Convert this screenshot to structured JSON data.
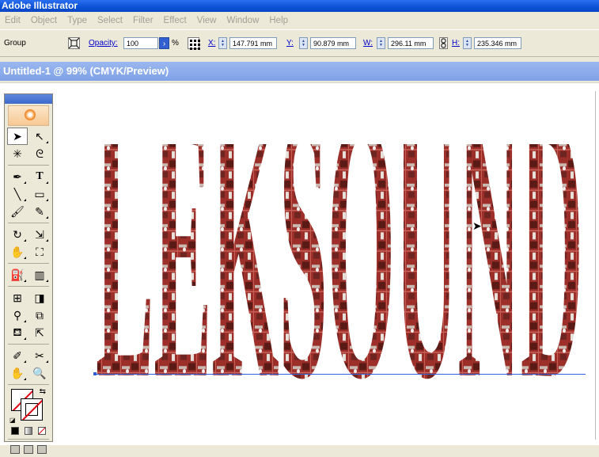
{
  "app": {
    "title": "Adobe Illustrator"
  },
  "menu": [
    "Edit",
    "Object",
    "Type",
    "Select",
    "Filter",
    "Effect",
    "View",
    "Window",
    "Help"
  ],
  "control": {
    "selection": "Group",
    "opacity_label": "Opacity:",
    "opacity_value": "100",
    "opacity_unit": "%",
    "x_label": "X:",
    "x_value": "147.791 mm",
    "y_label": "Y:",
    "y_value": "90.879 mm",
    "w_label": "W:",
    "w_value": "296.11 mm",
    "h_label": "H:",
    "h_value": "235.346 mm"
  },
  "document": {
    "title": "Untitled-1 @ 99% (CMYK/Preview)"
  },
  "artwork": {
    "text": "LEKSOUND",
    "fill_base": "#9c2f2a",
    "fill_dark": "#5a1a16"
  },
  "colors": {
    "selection": "#2f5fdc",
    "title_bar": "#0b52d6",
    "doc_title_bar": "#7fa1e6"
  },
  "tools": [
    "selection-tool",
    "direct-selection-tool",
    "magic-wand-tool",
    "lasso-tool",
    "pen-tool",
    "type-tool",
    "line-segment-tool",
    "rectangle-tool",
    "paintbrush-tool",
    "pencil-tool",
    "rotate-tool",
    "scale-tool",
    "warp-tool",
    "free-transform-tool",
    "symbol-sprayer-tool",
    "column-graph-tool",
    "mesh-tool",
    "gradient-tool",
    "eyedropper-tool",
    "blend-tool",
    "live-paint-bucket-tool",
    "live-paint-selection-tool",
    "slice-tool",
    "scissors-tool",
    "hand-tool",
    "zoom-tool"
  ]
}
